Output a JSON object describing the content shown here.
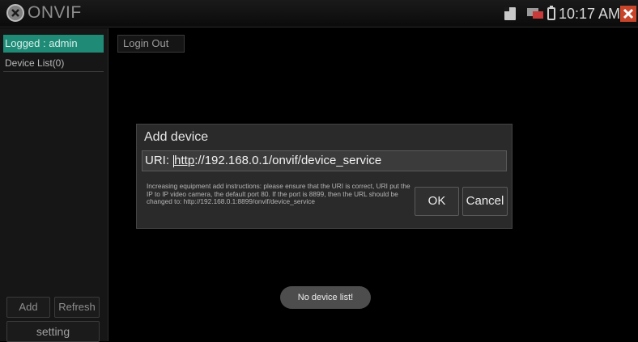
{
  "header": {
    "app_title": "ONVIF",
    "clock": "10:17 AM",
    "icons": [
      "onvif-logo-icon",
      "sd-card-icon",
      "network-icon",
      "battery-icon",
      "close-icon"
    ],
    "close_color": "#c8452a"
  },
  "sidebar": {
    "logged_in": "Logged : admin",
    "device_list": "Device List(0)",
    "add_label": "Add",
    "refresh_label": "Refresh",
    "setting_label": "setting",
    "accent_color": "#1f8b76"
  },
  "main": {
    "login_out_label": "Login Out"
  },
  "dialog": {
    "title": "Add device",
    "uri_prefix": "URI: ",
    "uri_link": "http",
    "uri_rest": "://192.168.0.1/onvif/device_service",
    "instructions": "Increasing equipment add instructions: please ensure that the URI is correct, URI put the IP to IP video camera, the default port 80. If the port is 8899, then the URL should be changed to: http://192.168.0.1:8899/onvif/device_service",
    "ok_label": "OK",
    "cancel_label": "Cancel"
  },
  "toast": {
    "message": "No device list!"
  }
}
